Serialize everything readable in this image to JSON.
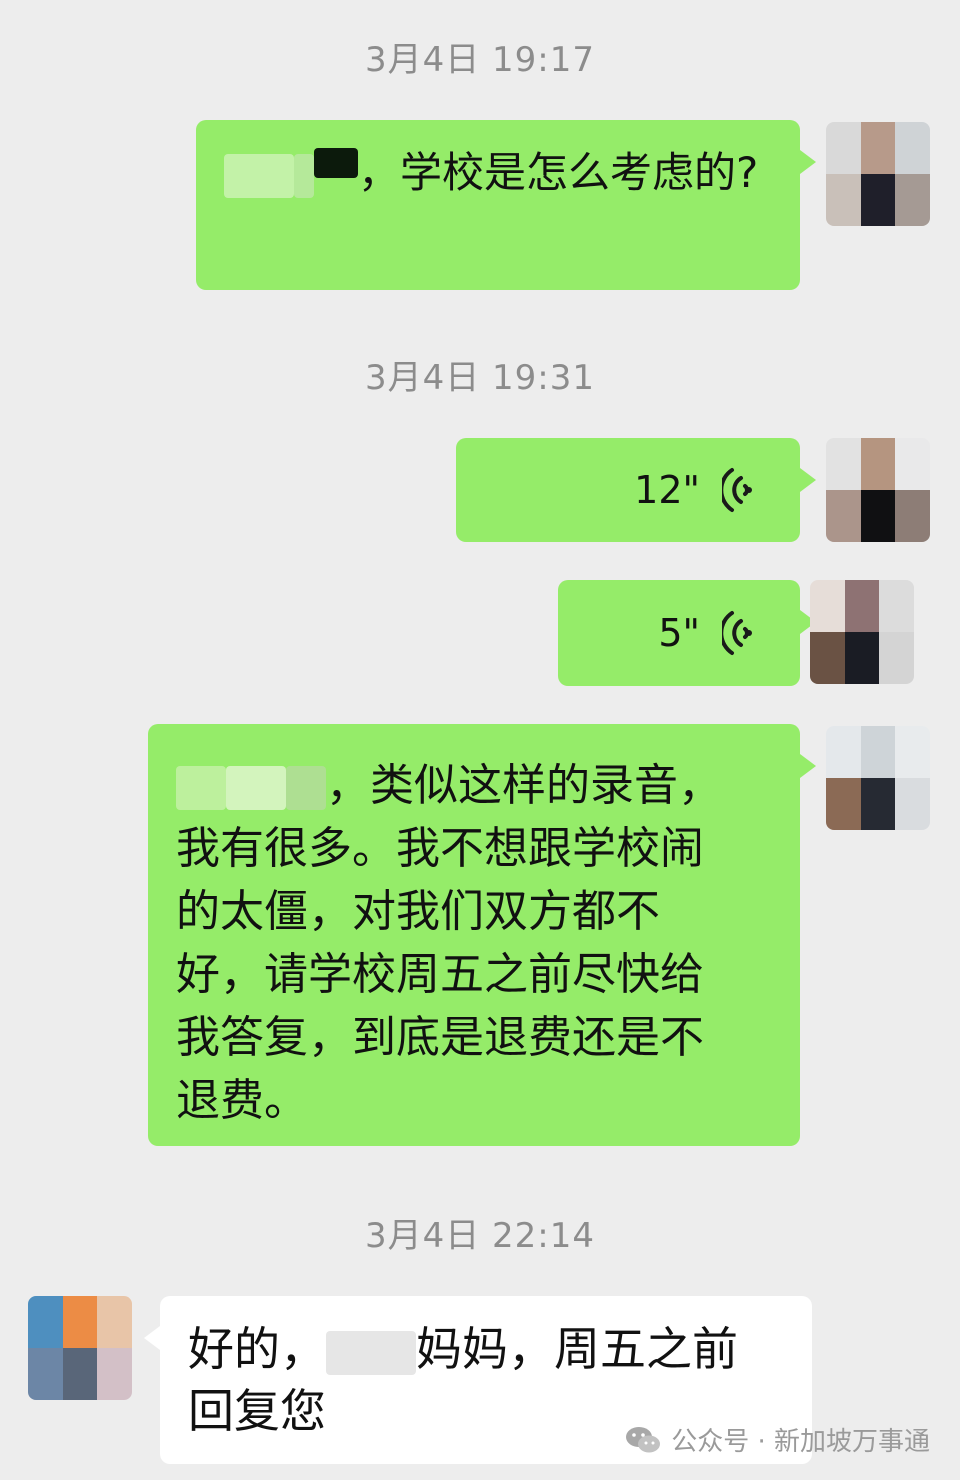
{
  "messages": {
    "ts1": "3月4日 19:17",
    "msg1_text": "，学校是怎么考虑的?",
    "ts2": "3月4日 19:31",
    "voice1": "12\"",
    "voice2": "5\"",
    "msg2_line1": "，类似这样的录音，",
    "msg2_rest": "我有很多。我不想跟学校闹\n的太僵，对我们双方都不\n好，请学校周五之前尽快给\n我答复，到底是退费还是不\n退费。",
    "ts3": "3月4日 22:14",
    "msg3_part1": "好的，",
    "msg3_part2": "妈妈，周五之前",
    "msg3_line2": "回复您"
  },
  "watermark": {
    "text": "公众号 · 新加坡万事通"
  },
  "colors": {
    "background": "#ededed",
    "sent_bubble": "#95ec69",
    "received_bubble": "#ffffff",
    "timestamp": "#8c8c8c"
  },
  "icons": {
    "voice": "voice-wave-icon",
    "watermark": "wechat-icon"
  }
}
